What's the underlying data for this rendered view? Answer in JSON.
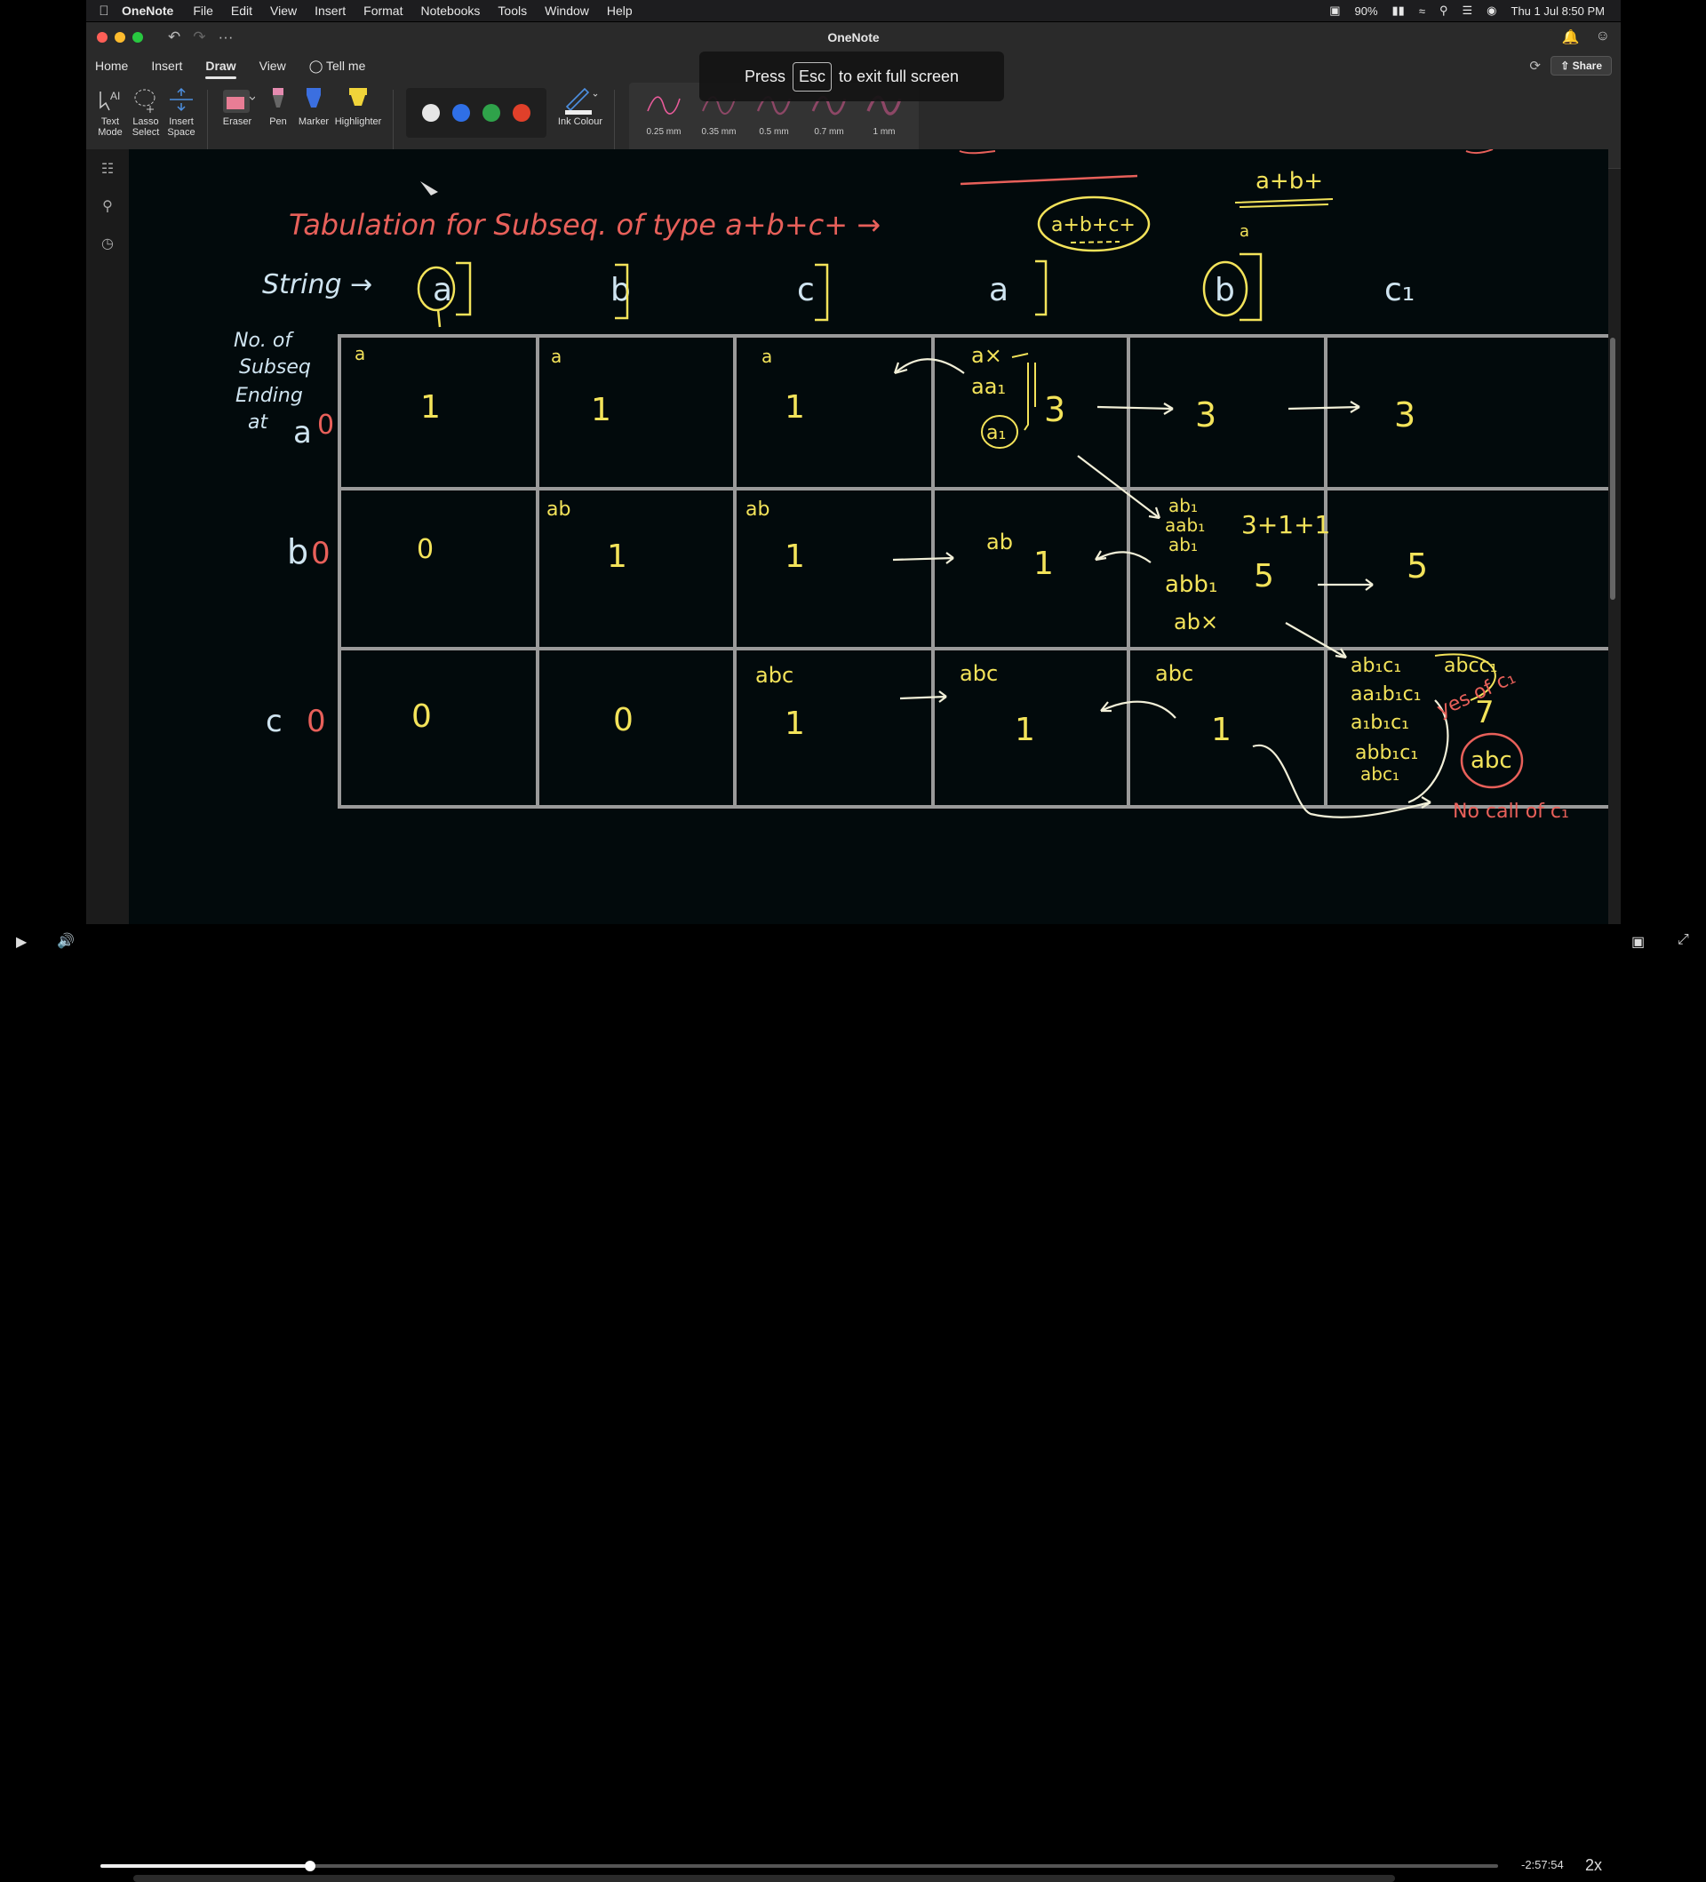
{
  "menubar": {
    "app_name": "OneNote",
    "items": [
      "File",
      "Edit",
      "View",
      "Insert",
      "Format",
      "Notebooks",
      "Tools",
      "Window",
      "Help"
    ],
    "battery": "90%",
    "datetime": "Thu 1 Jul  8:50 PM"
  },
  "window": {
    "title": "OneNote",
    "tabs": [
      "Home",
      "Insert",
      "Draw",
      "View"
    ],
    "active_tab": "Draw",
    "tell_me": "Tell me",
    "share_label": "Share"
  },
  "ribbon": {
    "text_mode": "Text Mode",
    "lasso_select": "Lasso Select",
    "insert_space": "Insert Space",
    "eraser": "Eraser",
    "pen": "Pen",
    "marker": "Marker",
    "highlighter": "Highlighter",
    "ink_colour": "Ink Colour",
    "colors": [
      "#e6e6e6",
      "#2f6fe6",
      "#2fa24a",
      "#e0402a"
    ],
    "thickness": [
      "0.25 mm",
      "0.35 mm",
      "0.5 mm",
      "0.7 mm",
      "1 mm"
    ]
  },
  "fullscreen_hint": {
    "press": "Press",
    "key": "Esc",
    "suffix": "to exit full screen"
  },
  "canvas": {
    "heading": "Tabulation for Subseq. of type a+b+c+ →",
    "circled_label": "a+b+c+",
    "top_right_note": "a+b+",
    "top_right_sub": "a",
    "string_label": "String →",
    "string_chars": [
      "a",
      "b",
      "c",
      "a",
      "b",
      "c₁"
    ],
    "row_caption": "No. of Subseq Ending at",
    "row_labels": [
      {
        "char": "a",
        "init": "0"
      },
      {
        "char": "b",
        "init": "0"
      },
      {
        "char": "c",
        "init": "0"
      }
    ],
    "grid": [
      [
        {
          "note": "a",
          "value": "1"
        },
        {
          "note": "a",
          "value": "1"
        },
        {
          "note": "a",
          "value": "1"
        },
        {
          "note": "a×, aa₁, a₁",
          "value": "3"
        },
        {
          "note": "",
          "value": "3"
        },
        {
          "note": "",
          "value": "3"
        }
      ],
      [
        {
          "note": "",
          "value": "0"
        },
        {
          "note": "ab",
          "value": "1"
        },
        {
          "note": "ab",
          "value": "1"
        },
        {
          "note": "ab",
          "value": "1"
        },
        {
          "note": "ab₁, aab₁, ab₁, abb₁, ab×",
          "value": "5",
          "extra": "3+1+1"
        },
        {
          "note": "",
          "value": "5"
        }
      ],
      [
        {
          "note": "",
          "value": "0"
        },
        {
          "note": "",
          "value": "0"
        },
        {
          "note": "abc",
          "value": "1"
        },
        {
          "note": "abc",
          "value": "1"
        },
        {
          "note": "abc",
          "value": "1"
        },
        {
          "note": "ab₁c₁, aa₁b₁c₁, a₁b₁c₁, abb₁c₁, abc₁",
          "value": "7",
          "extra": "abcc₁"
        }
      ]
    ],
    "side_notes": [
      "yes of c₁",
      "abc",
      "No call of c₁"
    ]
  },
  "player": {
    "remaining": "-2:57:54",
    "speed": "2x",
    "progress": 0.15
  }
}
